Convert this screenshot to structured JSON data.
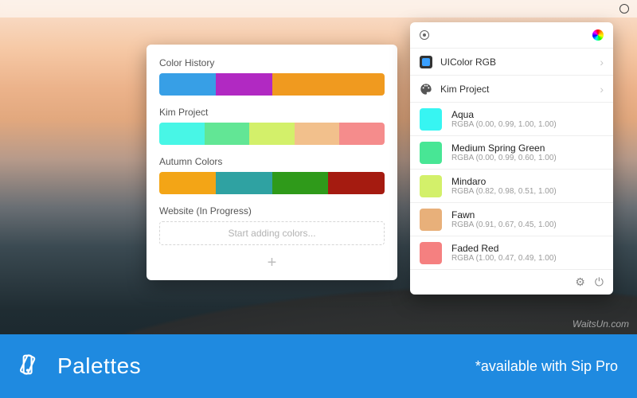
{
  "menubar": {
    "apple_glyph": ""
  },
  "left_panel": {
    "sections": [
      {
        "title": "Color History",
        "colors": [
          "#379fe6",
          "#b129c2",
          "#f09a1f",
          "#f09a1f"
        ]
      },
      {
        "title": "Kim Project",
        "colors": [
          "#48f6e6",
          "#62e695",
          "#d3f06a",
          "#f2c08c",
          "#f58c8c"
        ]
      },
      {
        "title": "Autumn Colors",
        "colors": [
          "#f3a516",
          "#2fa2a2",
          "#2f9a1a",
          "#a51b10"
        ]
      }
    ],
    "empty_section_title": "Website (In Progress)",
    "empty_placeholder": "Start adding colors...",
    "add_glyph": "+"
  },
  "right_panel": {
    "rows": [
      {
        "label": "UIColor RGB"
      },
      {
        "label": "Kim Project"
      }
    ],
    "colors": [
      {
        "name": "Aqua",
        "code": "RGBA (0.00, 0.99, 1.00, 1.00)",
        "hex": "#37f5f2"
      },
      {
        "name": "Medium Spring Green",
        "code": "RGBA (0.00, 0.99, 0.60, 1.00)",
        "hex": "#48e695"
      },
      {
        "name": "Mindaro",
        "code": "RGBA (0.82, 0.98, 0.51, 1.00)",
        "hex": "#d3f06a"
      },
      {
        "name": "Fawn",
        "code": "RGBA (0.91, 0.67, 0.45, 1.00)",
        "hex": "#e8b07a"
      },
      {
        "name": "Faded Red",
        "code": "RGBA (1.00, 0.47, 0.49, 1.00)",
        "hex": "#f58080"
      }
    ]
  },
  "footer": {
    "title": "Palettes",
    "subtitle": "*available with Sip Pro"
  },
  "watermark": "WaitsUn.com"
}
